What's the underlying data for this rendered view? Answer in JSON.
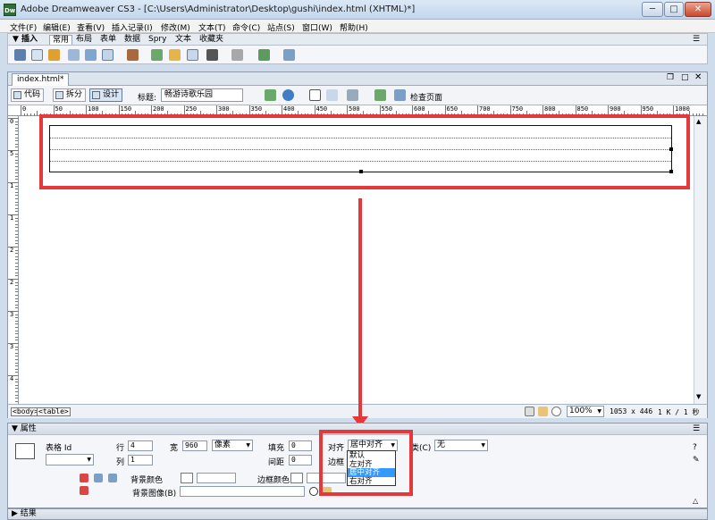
{
  "app": {
    "icon_text": "Dw",
    "title": "Adobe Dreamweaver CS3 - [C:\\Users\\Administrator\\Desktop\\gushi\\index.html (XHTML)*]",
    "window_buttons": {
      "minimize": "─",
      "maximize": "□",
      "close": "✕"
    }
  },
  "menu": [
    "文件(F)",
    "编辑(E)",
    "查看(V)",
    "插入记录(I)",
    "修改(M)",
    "文本(T)",
    "命令(C)",
    "站点(S)",
    "窗口(W)",
    "帮助(H)"
  ],
  "insert_bar": {
    "label": "▼ 插入",
    "tabs": [
      "常用",
      "布局",
      "表单",
      "数据",
      "Spry",
      "文本",
      "收藏夹"
    ],
    "active_tab": "常用"
  },
  "document": {
    "tab_label": "index.html*",
    "view_buttons": [
      "代码",
      "拆分",
      "设计"
    ],
    "active_view": "设计",
    "title_label": "标题:",
    "title_value": "畅游诗歌乐园",
    "check_page_label": "检查页面",
    "ruler_labels": [
      "0",
      "50",
      "100",
      "150",
      "200",
      "250",
      "300",
      "350",
      "400",
      "450",
      "500",
      "550",
      "600",
      "650",
      "700",
      "750",
      "800",
      "850",
      "900",
      "950",
      "1000"
    ],
    "vruler_labels": [
      "0",
      "5",
      "1",
      "1",
      "2",
      "2",
      "3",
      "3",
      "4",
      "4"
    ],
    "tag_selector": [
      "<body>",
      "<table>"
    ],
    "zoom": "100%",
    "dimensions": "1053 x 446",
    "file_size": "1 K / 1 秒"
  },
  "properties": {
    "header": "▼ 属性",
    "table_label": "表格 Id",
    "rows_label": "行",
    "rows_value": "4",
    "cols_label": "列",
    "cols_value": "1",
    "width_label": "宽",
    "width_value": "960",
    "width_unit": "像素",
    "cellpad_label": "填充",
    "cellpad_value": "0",
    "cellspace_label": "间距",
    "cellspace_value": "0",
    "align_label": "对齐",
    "align_value": "居中对齐",
    "align_options": [
      "默认",
      "左对齐",
      "居中对齐",
      "右对齐"
    ],
    "align_selected_index": 2,
    "border_label": "边框",
    "class_label": "类(C)",
    "class_value": "无",
    "bgcolor_label": "背景颜色",
    "bordercolor_label": "边框颜色",
    "bgimage_label": "背景图像(B)"
  },
  "results": {
    "label": "▶ 结果"
  },
  "colors": {
    "annotation_red": "#e5383b",
    "dropdown_highlight": "#3399ff"
  }
}
